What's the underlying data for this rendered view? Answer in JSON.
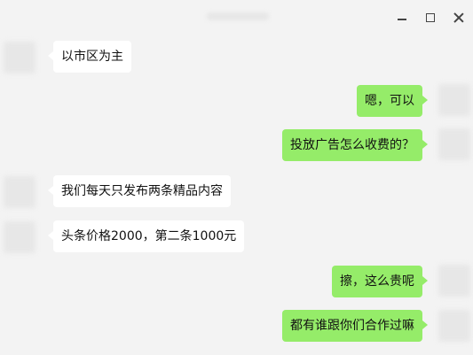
{
  "window": {
    "minimize_icon": "minimize-icon",
    "maximize_icon": "maximize-icon",
    "close_icon": "close-icon"
  },
  "colors": {
    "background": "#f3f3f3",
    "incoming_bubble": "#ffffff",
    "outgoing_bubble": "#95ec69"
  },
  "messages": [
    {
      "direction": "incoming",
      "text": "以市区为主"
    },
    {
      "direction": "outgoing",
      "text": "嗯，可以"
    },
    {
      "direction": "outgoing",
      "text": "投放广告怎么收费的？"
    },
    {
      "direction": "incoming",
      "text": "我们每天只发布两条精品内容"
    },
    {
      "direction": "incoming",
      "text": "头条价格2000，第二条1000元"
    },
    {
      "direction": "outgoing",
      "text": "擦，这么贵呢"
    },
    {
      "direction": "outgoing",
      "text": "都有谁跟你们合作过嘛"
    }
  ]
}
